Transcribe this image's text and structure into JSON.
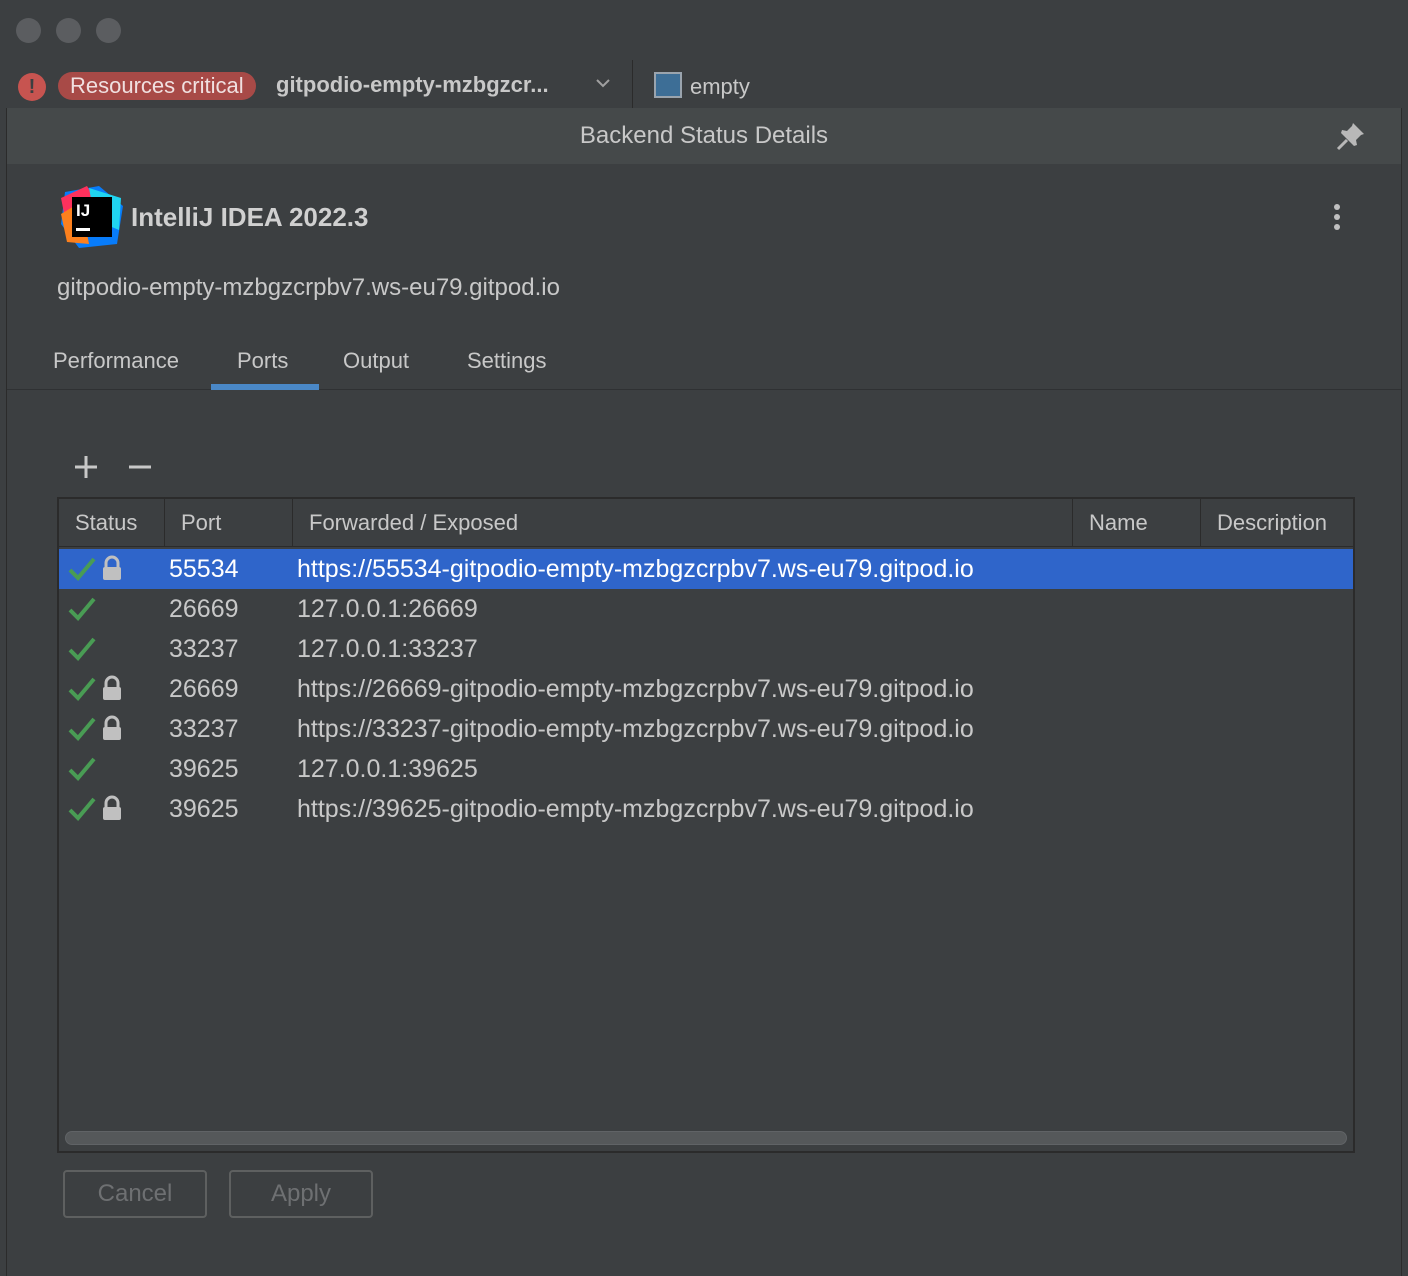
{
  "toolbar": {
    "status_badge": "Resources critical",
    "workspace_name": "gitpodio-empty-mzbgzcr...",
    "project_name": "empty"
  },
  "popup": {
    "title": "Backend Status Details",
    "product_name": "IntelliJ IDEA 2022.3",
    "logo_text": "IJ",
    "host": "gitpodio-empty-mzbgzcrpbv7.ws-eu79.gitpod.io"
  },
  "tabs": [
    {
      "label": "Performance"
    },
    {
      "label": "Ports",
      "selected": true
    },
    {
      "label": "Output"
    },
    {
      "label": "Settings"
    }
  ],
  "table": {
    "columns": [
      "Status",
      "Port",
      "Forwarded / Exposed",
      "Name",
      "Description"
    ],
    "rows": [
      {
        "status": "ok",
        "locked": true,
        "port": "55534",
        "forwarded": "https://55534-gitpodio-empty-mzbgzcrpbv7.ws-eu79.gitpod.io",
        "selected": true
      },
      {
        "status": "ok",
        "locked": false,
        "port": "26669",
        "forwarded": "127.0.0.1:26669"
      },
      {
        "status": "ok",
        "locked": false,
        "port": "33237",
        "forwarded": "127.0.0.1:33237"
      },
      {
        "status": "ok",
        "locked": true,
        "port": "26669",
        "forwarded": "https://26669-gitpodio-empty-mzbgzcrpbv7.ws-eu79.gitpod.io"
      },
      {
        "status": "ok",
        "locked": true,
        "port": "33237",
        "forwarded": "https://33237-gitpodio-empty-mzbgzcrpbv7.ws-eu79.gitpod.io"
      },
      {
        "status": "ok",
        "locked": false,
        "port": "39625",
        "forwarded": "127.0.0.1:39625"
      },
      {
        "status": "ok",
        "locked": true,
        "port": "39625",
        "forwarded": "https://39625-gitpodio-empty-mzbgzcrpbv7.ws-eu79.gitpod.io"
      }
    ]
  },
  "buttons": {
    "cancel": "Cancel",
    "apply": "Apply"
  },
  "colors": {
    "background": "#3c3f41",
    "selection": "#2f65ca",
    "error": "#c75450",
    "check": "#499c54",
    "tab_underline": "#4a88c7"
  },
  "icons": {
    "error": "error-icon",
    "chevron": "chevron-down-icon",
    "project": "project-window-icon",
    "pin": "pin-icon",
    "more": "more-vertical-icon",
    "add": "plus-icon",
    "remove": "minus-icon",
    "status": "check-icon",
    "lock": "lock-icon"
  }
}
